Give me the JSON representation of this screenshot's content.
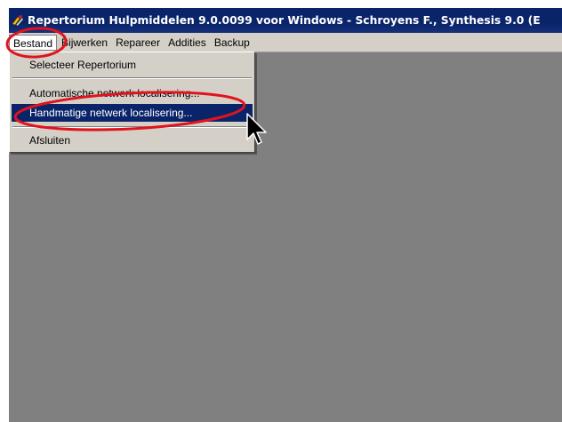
{
  "window": {
    "title": "Repertorium Hulpmiddelen 9.0.0099 voor Windows - Schroyens F., Synthesis 9.0 (E",
    "icon": "app-icon"
  },
  "menubar": {
    "items": [
      {
        "label": "Bestand",
        "active": true
      },
      {
        "label": "Bijwerken"
      },
      {
        "label": "Repareer"
      },
      {
        "label": "Addities"
      },
      {
        "label": "Backup"
      }
    ]
  },
  "dropdown": {
    "items": [
      {
        "label": "Selecteer Repertorium"
      },
      {
        "label": "Automatische netwerk localisering..."
      },
      {
        "label": "Handmatige netwerk localisering...",
        "highlighted": true
      },
      {
        "label": "Afsluiten"
      }
    ]
  },
  "colors": {
    "titlebar": "#0a246a",
    "highlight": "#0a246a",
    "annotation": "#e0141e",
    "workspace": "#808080",
    "menu": "#d4d0c8"
  }
}
